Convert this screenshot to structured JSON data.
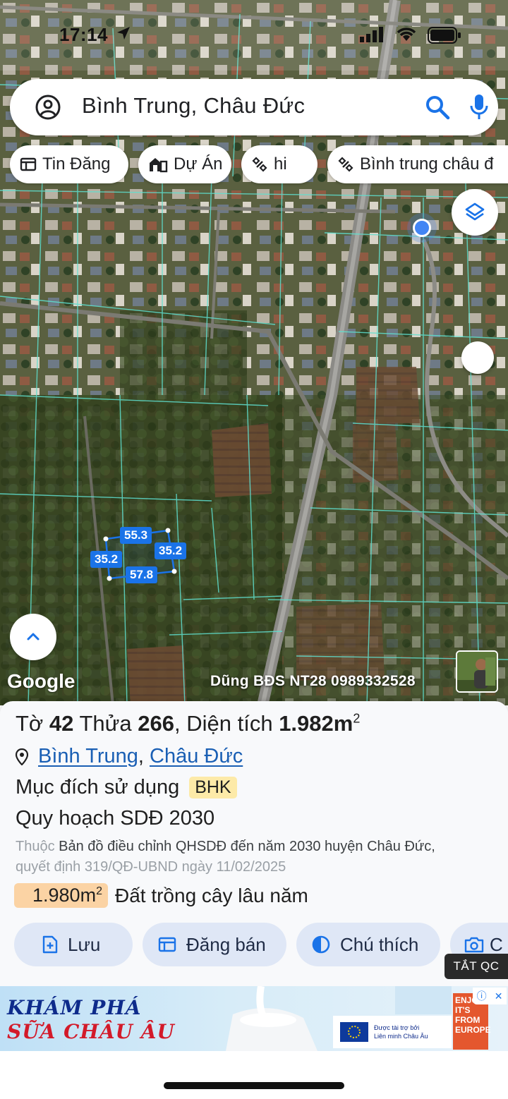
{
  "status_bar": {
    "time": "17:14"
  },
  "search": {
    "query": "Bình Trung, Châu Đức"
  },
  "chips": [
    {
      "label": "Tin Đăng",
      "icon": "listing-icon"
    },
    {
      "label": "Dự Án",
      "icon": "building-icon"
    },
    {
      "label": "hi",
      "icon": "satellite-icon"
    },
    {
      "label": "Bình trung châu đ",
      "icon": "satellite-icon"
    }
  ],
  "parcel_dimensions": {
    "top": "55.3",
    "right": "35.2",
    "left": "35.2",
    "bottom": "57.8"
  },
  "map": {
    "logo": "Google",
    "watermark": "Dũng BĐS NT28 0989332528"
  },
  "parcel": {
    "sheet_label": "Tờ",
    "sheet_no": "42",
    "lot_label": "Thửa",
    "lot_no": "266",
    "area_label": "Diện tích",
    "area_value": "1.982m",
    "area_unit_sup": "2",
    "location_1": "Bình Trung",
    "location_2": "Châu Đức",
    "purpose_label": "Mục đích sử dụng",
    "purpose_code": "BHK",
    "plan_title": "Quy hoạch SDĐ 2030",
    "plan_note_prefix": "Thuộc",
    "plan_note_main": "Bản đồ điều chỉnh QHSDĐ đến năm 2030 huyện Châu Đức,",
    "plan_note_decision": "quyết định 319/QĐ-UBND ngày 11/02/2025",
    "plan_area_value": "1.980m",
    "plan_area_sup": "2",
    "plan_area_type": "Đất trồng cây lâu năm"
  },
  "actions": [
    {
      "label": "Lưu",
      "icon": "save-add-icon"
    },
    {
      "label": "Đăng bán",
      "icon": "post-listing-icon"
    },
    {
      "label": "Chú thích",
      "icon": "legend-icon"
    },
    {
      "label": "C",
      "icon": "camera-icon"
    }
  ],
  "ads_toggle": "TẮT QC",
  "ad": {
    "headline_1": "KHÁM PHÁ",
    "headline_2": "SỮA CHÂU ÂU",
    "eu_text_1": "Được tài trợ bởi",
    "eu_text_2": "Liên minh Châu Âu",
    "enjoy_text": "ENJOY IT'S FROM EUROPE"
  },
  "colors": {
    "accent": "#1a73e8",
    "chip_bg": "#ffffff",
    "action_bg": "#dfe7f6",
    "area_badge": "#fbd3a4",
    "purpose_badge": "#fdeaa8",
    "parcel_outline": "#1a73e8"
  }
}
